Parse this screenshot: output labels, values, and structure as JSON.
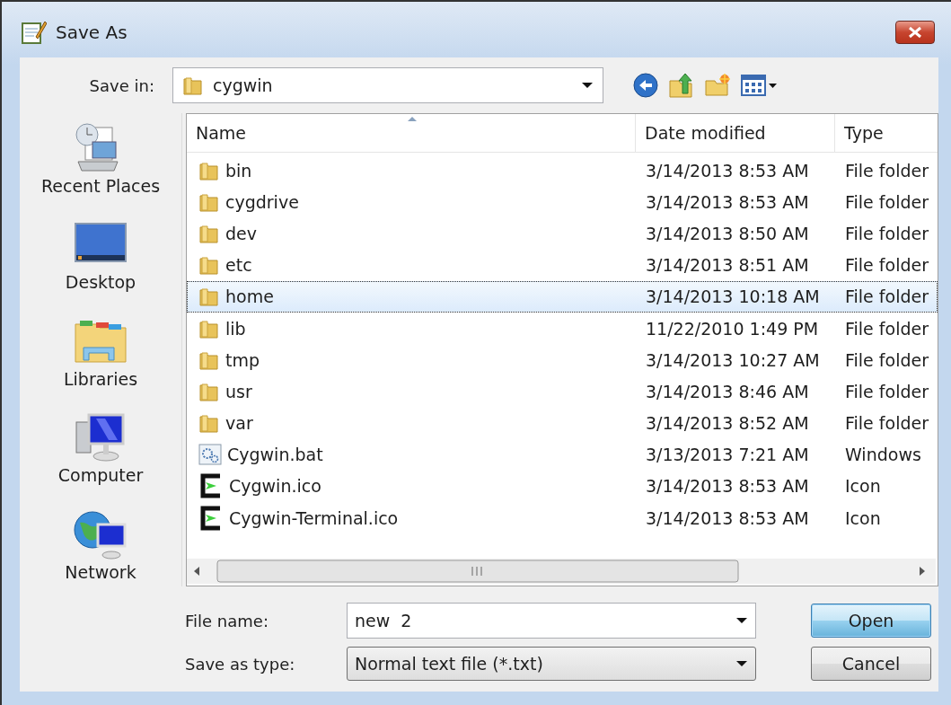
{
  "window": {
    "title": "Save As"
  },
  "save_in": {
    "label": "Save in:",
    "value": "cygwin"
  },
  "sidebar": {
    "items": [
      {
        "kind": "recent",
        "label": "Recent Places"
      },
      {
        "kind": "desktop",
        "label": "Desktop"
      },
      {
        "kind": "libraries",
        "label": "Libraries"
      },
      {
        "kind": "computer",
        "label": "Computer"
      },
      {
        "kind": "network",
        "label": "Network"
      }
    ]
  },
  "table": {
    "columns": [
      "Name",
      "Date modified",
      "Type"
    ],
    "rows": [
      {
        "kind": "folder",
        "name": "bin",
        "date": "3/14/2013 8:53 AM",
        "type": "File folder",
        "selected": false
      },
      {
        "kind": "folder",
        "name": "cygdrive",
        "date": "3/14/2013 8:53 AM",
        "type": "File folder",
        "selected": false
      },
      {
        "kind": "folder",
        "name": "dev",
        "date": "3/14/2013 8:50 AM",
        "type": "File folder",
        "selected": false
      },
      {
        "kind": "folder",
        "name": "etc",
        "date": "3/14/2013 8:51 AM",
        "type": "File folder",
        "selected": false
      },
      {
        "kind": "folder",
        "name": "home",
        "date": "3/14/2013 10:18 AM",
        "type": "File folder",
        "selected": true
      },
      {
        "kind": "folder",
        "name": "lib",
        "date": "11/22/2010 1:49 PM",
        "type": "File folder",
        "selected": false
      },
      {
        "kind": "folder",
        "name": "tmp",
        "date": "3/14/2013 10:27 AM",
        "type": "File folder",
        "selected": false
      },
      {
        "kind": "folder",
        "name": "usr",
        "date": "3/14/2013 8:46 AM",
        "type": "File folder",
        "selected": false
      },
      {
        "kind": "folder",
        "name": "var",
        "date": "3/14/2013 8:52 AM",
        "type": "File folder",
        "selected": false
      },
      {
        "kind": "bat",
        "name": "Cygwin.bat",
        "date": "3/13/2013 7:21 AM",
        "type": "Windows",
        "selected": false
      },
      {
        "kind": "ico",
        "name": "Cygwin.ico",
        "date": "3/14/2013 8:53 AM",
        "type": "Icon",
        "selected": false
      },
      {
        "kind": "ico",
        "name": "Cygwin-Terminal.ico",
        "date": "3/14/2013 8:53 AM",
        "type": "Icon",
        "selected": false
      }
    ]
  },
  "file_name": {
    "label": "File name:",
    "value": "new  2"
  },
  "save_as_type": {
    "label": "Save as type:",
    "value": "Normal text file (*.txt)"
  },
  "buttons": [
    {
      "kind": "default",
      "label": "Open"
    },
    {
      "kind": "normal",
      "label": "Cancel"
    }
  ]
}
